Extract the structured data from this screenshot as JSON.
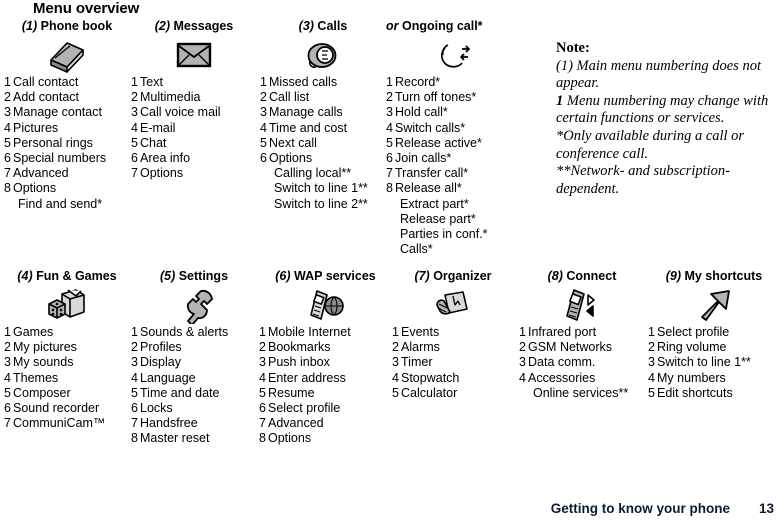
{
  "page": {
    "title": "Menu overview",
    "footer_title": "Getting to know your phone",
    "footer_page": "13",
    "footer_color": "#0d1b33"
  },
  "note": {
    "heading": "Note:",
    "line1": "(1) Main menu numbering does not appear.",
    "line2_lead": "1",
    "line2": " Menu numbering may change with certain functions or services.",
    "line3": "*Only available during a call or conference call.",
    "line4": "**Network- and subscription-dependent."
  },
  "menus": [
    {
      "number": "(1)",
      "title": "Phone book",
      "icon": "book-icon",
      "items": [
        {
          "idx": "1",
          "label": "Call contact"
        },
        {
          "idx": "2",
          "label": "Add contact"
        },
        {
          "idx": "3",
          "label": "Manage contact"
        },
        {
          "idx": "4",
          "label": "Pictures"
        },
        {
          "idx": "5",
          "label": "Personal rings"
        },
        {
          "idx": "6",
          "label": "Special numbers"
        },
        {
          "idx": "7",
          "label": "Advanced"
        },
        {
          "idx": "8",
          "label": "Options"
        },
        {
          "idx": "",
          "label": "Find and send*",
          "sub": true
        }
      ]
    },
    {
      "number": "(2)",
      "title": "Messages",
      "icon": "envelope-icon",
      "items": [
        {
          "idx": "1",
          "label": "Text"
        },
        {
          "idx": "2",
          "label": "Multimedia"
        },
        {
          "idx": "3",
          "label": "Call voice mail"
        },
        {
          "idx": "4",
          "label": "E-mail"
        },
        {
          "idx": "5",
          "label": "Chat"
        },
        {
          "idx": "6",
          "label": "Area info"
        },
        {
          "idx": "7",
          "label": "Options"
        }
      ]
    },
    {
      "number": "(3)",
      "title": "Calls",
      "icon": "handset-icon",
      "items": [
        {
          "idx": "1",
          "label": "Missed calls"
        },
        {
          "idx": "2",
          "label": "Call list"
        },
        {
          "idx": "3",
          "label": "Manage calls"
        },
        {
          "idx": "4",
          "label": "Time and cost"
        },
        {
          "idx": "5",
          "label": "Next call"
        },
        {
          "idx": "6",
          "label": "Options"
        },
        {
          "idx": "",
          "label": "Calling local**",
          "sub": true
        },
        {
          "idx": "",
          "label": "Switch to line 1**",
          "sub": true
        },
        {
          "idx": "",
          "label": "Switch to line 2**",
          "sub": true
        }
      ]
    },
    {
      "number": "or",
      "title": "Ongoing call*",
      "icon": "ongoing-call-icon",
      "items": [
        {
          "idx": "1",
          "label": "Record*"
        },
        {
          "idx": "2",
          "label": "Turn off tones*"
        },
        {
          "idx": "3",
          "label": "Hold call*"
        },
        {
          "idx": "4",
          "label": "Switch calls*"
        },
        {
          "idx": "5",
          "label": "Release active*"
        },
        {
          "idx": "6",
          "label": "Join calls*"
        },
        {
          "idx": "7",
          "label": "Transfer call*"
        },
        {
          "idx": "8",
          "label": "Release all*"
        },
        {
          "idx": "",
          "label": "Extract part*",
          "sub": true
        },
        {
          "idx": "",
          "label": "Release part*",
          "sub": true
        },
        {
          "idx": "",
          "label": "Parties in conf.*",
          "sub": true
        },
        {
          "idx": "",
          "label": "Calls*",
          "sub": true
        }
      ]
    },
    {
      "number": "(4)",
      "title": "Fun & Games",
      "icon": "dice-box-icon",
      "items": [
        {
          "idx": "1",
          "label": "Games"
        },
        {
          "idx": "2",
          "label": "My pictures"
        },
        {
          "idx": "3",
          "label": "My sounds"
        },
        {
          "idx": "4",
          "label": "Themes"
        },
        {
          "idx": "5",
          "label": "Composer"
        },
        {
          "idx": "6",
          "label": "Sound recorder"
        },
        {
          "idx": "7",
          "label": "CommuniCam™"
        }
      ]
    },
    {
      "number": "(5)",
      "title": "Settings",
      "icon": "wrench-icon",
      "items": [
        {
          "idx": "1",
          "label": "Sounds & alerts"
        },
        {
          "idx": "2",
          "label": "Profiles"
        },
        {
          "idx": "3",
          "label": "Display"
        },
        {
          "idx": "4",
          "label": "Language"
        },
        {
          "idx": "5",
          "label": "Time and date"
        },
        {
          "idx": "6",
          "label": "Locks"
        },
        {
          "idx": "7",
          "label": "Handsfree"
        },
        {
          "idx": "8",
          "label": "Master reset"
        }
      ]
    },
    {
      "number": "(6)",
      "title": "WAP services",
      "icon": "phone-globe-icon",
      "items": [
        {
          "idx": "1",
          "label": "Mobile Internet"
        },
        {
          "idx": "2",
          "label": "Bookmarks"
        },
        {
          "idx": "3",
          "label": "Push inbox"
        },
        {
          "idx": "4",
          "label": "Enter address"
        },
        {
          "idx": "5",
          "label": "Resume"
        },
        {
          "idx": "6",
          "label": "Select profile"
        },
        {
          "idx": "7",
          "label": "Advanced"
        },
        {
          "idx": "8",
          "label": "Options"
        }
      ]
    },
    {
      "number": "(7)",
      "title": "Organizer",
      "icon": "calendar-icon",
      "items": [
        {
          "idx": "1",
          "label": "Events"
        },
        {
          "idx": "2",
          "label": "Alarms"
        },
        {
          "idx": "3",
          "label": "Timer"
        },
        {
          "idx": "4",
          "label": "Stopwatch"
        },
        {
          "idx": "5",
          "label": "Calculator"
        }
      ]
    },
    {
      "number": "(8)",
      "title": "Connect",
      "icon": "phone-infrared-icon",
      "items": [
        {
          "idx": "1",
          "label": "Infrared port"
        },
        {
          "idx": "2",
          "label": "GSM Networks"
        },
        {
          "idx": "3",
          "label": "Data comm."
        },
        {
          "idx": "4",
          "label": "Accessories"
        },
        {
          "idx": "",
          "label": "Online services**",
          "sub": true
        }
      ]
    },
    {
      "number": "(9)",
      "title": "My shortcuts",
      "icon": "arrow-up-right-icon",
      "items": [
        {
          "idx": "1",
          "label": "Select profile"
        },
        {
          "idx": "2",
          "label": "Ring volume"
        },
        {
          "idx": "3",
          "label": "Switch to line 1**"
        },
        {
          "idx": "4",
          "label": "My numbers"
        },
        {
          "idx": "5",
          "label": "Edit shortcuts"
        }
      ]
    }
  ]
}
